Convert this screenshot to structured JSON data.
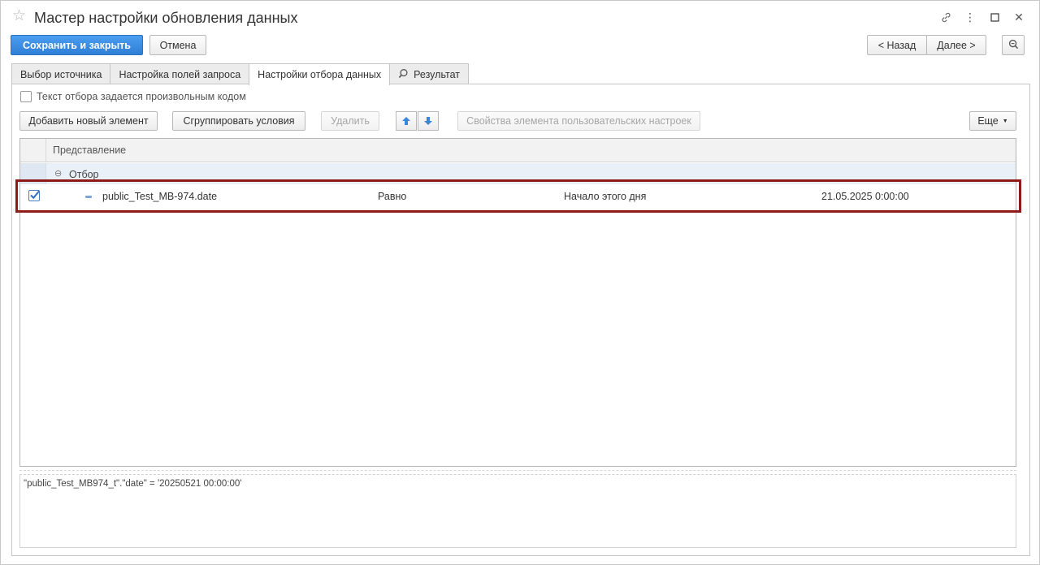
{
  "window": {
    "title": "Мастер настройки обновления данных",
    "controls": {
      "link": "🔗",
      "menu": "⋮",
      "maximize": "☐",
      "close": "✕"
    }
  },
  "toolbar": {
    "save_close": "Сохранить и закрыть",
    "cancel": "Отмена",
    "back": "< Назад",
    "next": "Далее >",
    "zoom_icon": "🔍"
  },
  "tabs": [
    {
      "label": "Выбор источника",
      "active": false
    },
    {
      "label": "Настройка полей запроса",
      "active": false
    },
    {
      "label": "Настройки отбора данных",
      "active": true
    },
    {
      "label": "Результат",
      "active": false,
      "icon": "search-icon"
    }
  ],
  "filter_panel": {
    "custom_code_checkbox_label": "Текст отбора задается произвольным кодом",
    "custom_code_checked": false,
    "add_element": "Добавить новый элемент",
    "group_conditions": "Сгруппировать условия",
    "delete": "Удалить",
    "properties": "Свойства элемента пользовательских настроек",
    "more": "Еще"
  },
  "grid": {
    "header": "Представление",
    "group_label": "Отбор",
    "rows": [
      {
        "checked": true,
        "field": "public_Test_MB-974.date",
        "comparison": "Равно",
        "period": "Начало этого дня",
        "value": "21.05.2025 0:00:00"
      }
    ]
  },
  "query_text": "\"public_Test_MB974_t\".\"date\" = '20250521 00:00:00'",
  "colors": {
    "primary": "#2f7fd6",
    "highlight": "#8e1a1a"
  }
}
